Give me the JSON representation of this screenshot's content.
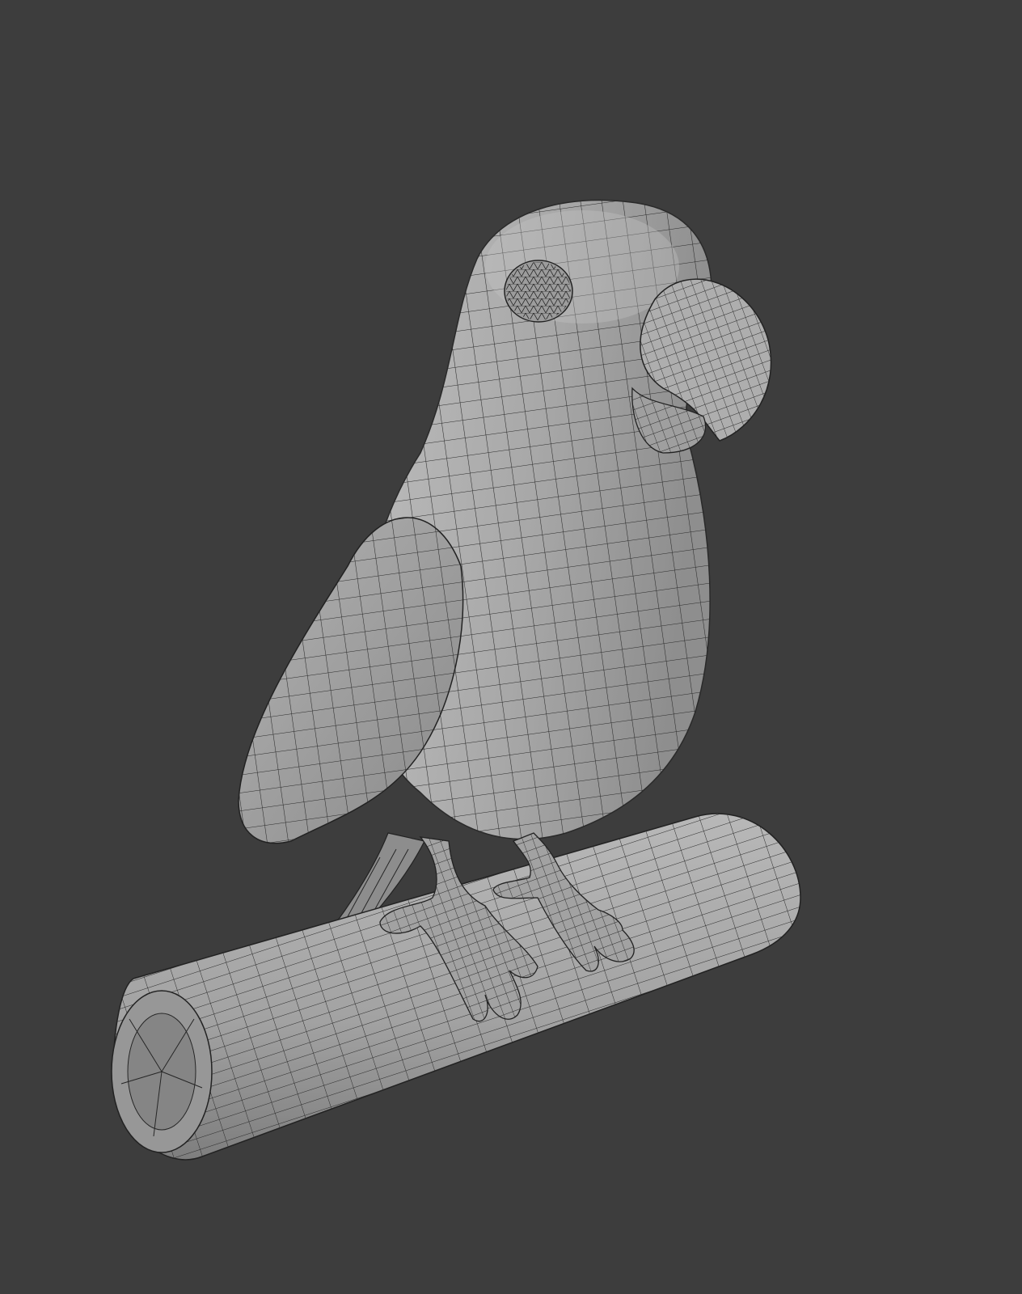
{
  "viewport": {
    "background_color": "#3d3d3d",
    "mode": "wireframe-overlay",
    "object_origin_color": "#e8a53a"
  },
  "model": {
    "mesh_color": "#a9a9a9",
    "wire_color": "#202020",
    "parts": [
      {
        "name": "parrot-body"
      },
      {
        "name": "parrot-head"
      },
      {
        "name": "parrot-eye"
      },
      {
        "name": "parrot-beak"
      },
      {
        "name": "parrot-wing"
      },
      {
        "name": "parrot-tail"
      },
      {
        "name": "parrot-left-foot"
      },
      {
        "name": "parrot-right-foot"
      },
      {
        "name": "branch-perch"
      }
    ]
  }
}
